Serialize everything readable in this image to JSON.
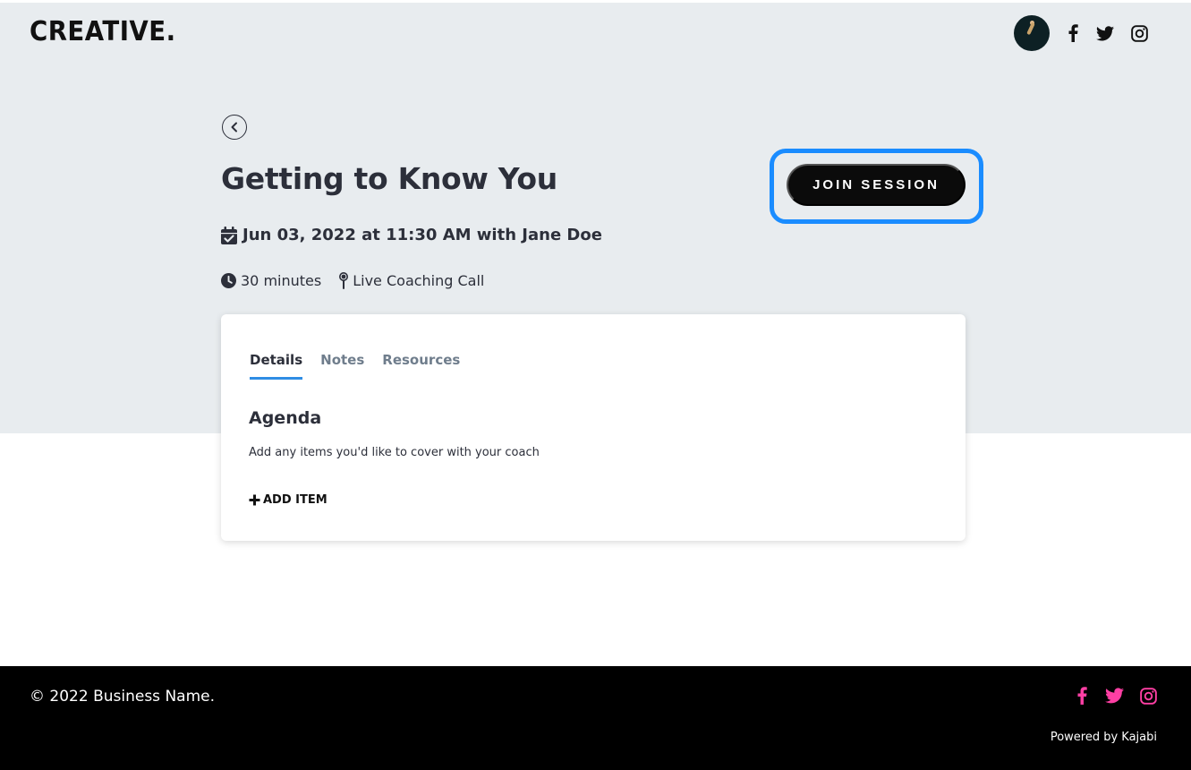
{
  "header": {
    "logo": "CREATIVE.",
    "avatar_icon": "user-avatar",
    "social_icons": [
      "facebook-icon",
      "twitter-icon",
      "instagram-icon"
    ]
  },
  "session": {
    "title": "Getting to Know You",
    "date_line": "Jun 03, 2022 at 11:30 AM with Jane Doe",
    "duration": "30 minutes",
    "location": "Live Coaching Call",
    "join_label": "JOIN SESSION",
    "join_highlight_color": "#1a8cff"
  },
  "tabs": [
    {
      "label": "Details",
      "active": true
    },
    {
      "label": "Notes",
      "active": false
    },
    {
      "label": "Resources",
      "active": false
    }
  ],
  "agenda": {
    "title": "Agenda",
    "description": "Add any items you'd like to cover with your coach",
    "add_label": "ADD ITEM"
  },
  "footer": {
    "copyright": "© 2022 Business Name.",
    "powered_by": "Powered by Kajabi",
    "social_color": "#ff3fa4"
  },
  "colors": {
    "hero_bg": "#e8ecef",
    "tab_active_underline": "#2f8de4",
    "button_bg": "#0b0b0b"
  }
}
